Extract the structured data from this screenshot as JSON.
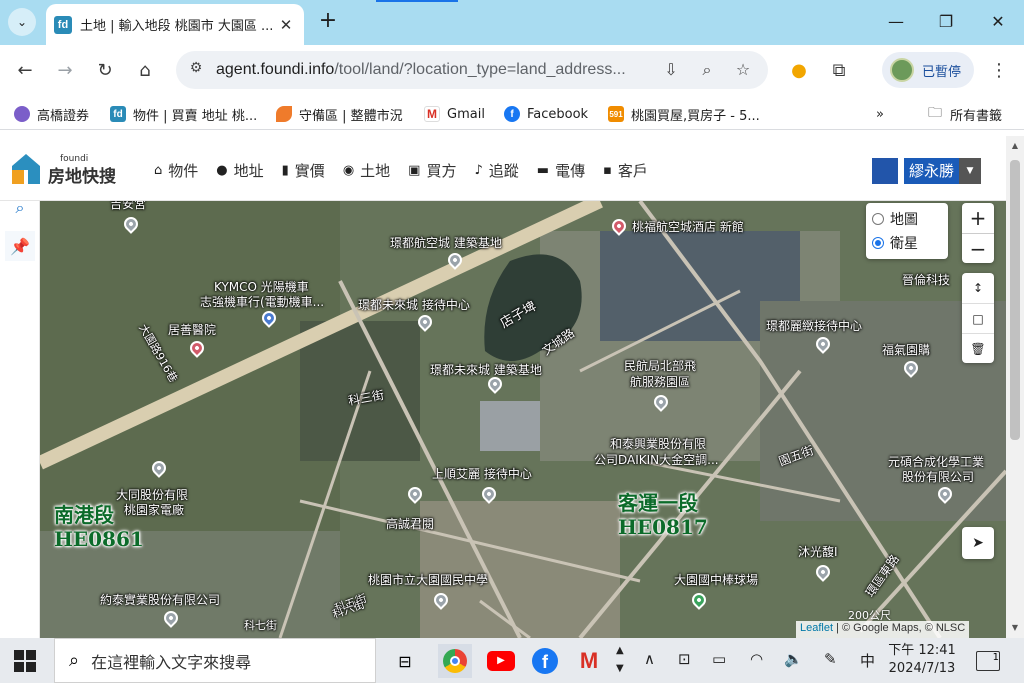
{
  "browser": {
    "tab_title": "土地 | 輸入地段 桃園市 大園區 ...",
    "tab_favicon": "fd",
    "url_main": "agent.foundi.info",
    "url_rest": "/tool/land/?location_type=land_address...",
    "profile_label": "已暫停"
  },
  "bookmarks": [
    {
      "label": "高橋證券",
      "icon": "globe-icon",
      "color": "#7b5ec9"
    },
    {
      "label": "物件 | 買賣 地址 桃...",
      "icon": "fd",
      "color": "#2a8bb7"
    },
    {
      "label": "守備區 | 整體市況",
      "icon": "leaf-icon",
      "color": "#ef7b2b"
    },
    {
      "label": "Gmail",
      "icon": "gmail-icon",
      "color": "#d93025"
    },
    {
      "label": "Facebook",
      "icon": "facebook-icon",
      "color": "#1877f2"
    },
    {
      "label": "桃園買屋,買房子 - 5...",
      "icon": "591",
      "color": "#f08c00"
    }
  ],
  "bookmarks_all": "所有書籤",
  "site": {
    "logo_small": "foundi",
    "logo_text": "房地快搜",
    "nav": [
      {
        "label": "物件",
        "icon": "home-icon"
      },
      {
        "label": "地址",
        "icon": "pin-icon"
      },
      {
        "label": "實價",
        "icon": "trash-icon"
      },
      {
        "label": "土地",
        "icon": "compass-icon"
      },
      {
        "label": "買方",
        "icon": "id-icon"
      },
      {
        "label": "追蹤",
        "icon": "bell-icon"
      },
      {
        "label": "電傳",
        "icon": "fax-icon"
      },
      {
        "label": "客戶",
        "icon": "client-icon"
      }
    ],
    "user_name": "繆永勝"
  },
  "map": {
    "layer_options": [
      "地圖",
      "衛星"
    ],
    "selected_layer": "衛星",
    "zoom_in": "+",
    "zoom_out": "−",
    "labels": [
      "吉安宮",
      "桃福航空城酒店 新館",
      "璟都航空城 建築基地",
      "KYMCO 光陽機車",
      "志強機車行(電動機車...",
      "璟都未來城 接待中心",
      "店子埤",
      "居善醫院",
      "大園路916巷",
      "璟都麗緻接待中心",
      "晉倫科技",
      "民航局北部飛",
      "航服務園區",
      "福氣園購",
      "文城路",
      "璟都未來城 建築基地",
      "科三街",
      "和泰興業股份有限",
      "公司DAIKIN大金空調...",
      "上順艾麗 接待中心",
      "元碩合成化學工業",
      "股份有限公司",
      "園五街",
      "大同股份有限",
      "桃園家電廠",
      "高誠君閱",
      "沐光馥I",
      "桃園市立大園國民中學",
      "大園國中棒球場",
      "約泰實業股份有限公司",
      "環區東路",
      "科五街",
      "科六街",
      "科七街"
    ],
    "land_sections": [
      {
        "name": "南港段",
        "code": "HE0861"
      },
      {
        "name": "客運一段",
        "code": "HE0817"
      }
    ],
    "scale": "200公尺",
    "attribution_leaflet": "Leaflet",
    "attribution_rest": "| © Google Maps, © NLSC"
  },
  "taskbar": {
    "search_placeholder": "在這裡輸入文字來搜尋",
    "ime": "中",
    "time": "下午 12:41",
    "date": "2024/7/13",
    "notifications": "1"
  }
}
